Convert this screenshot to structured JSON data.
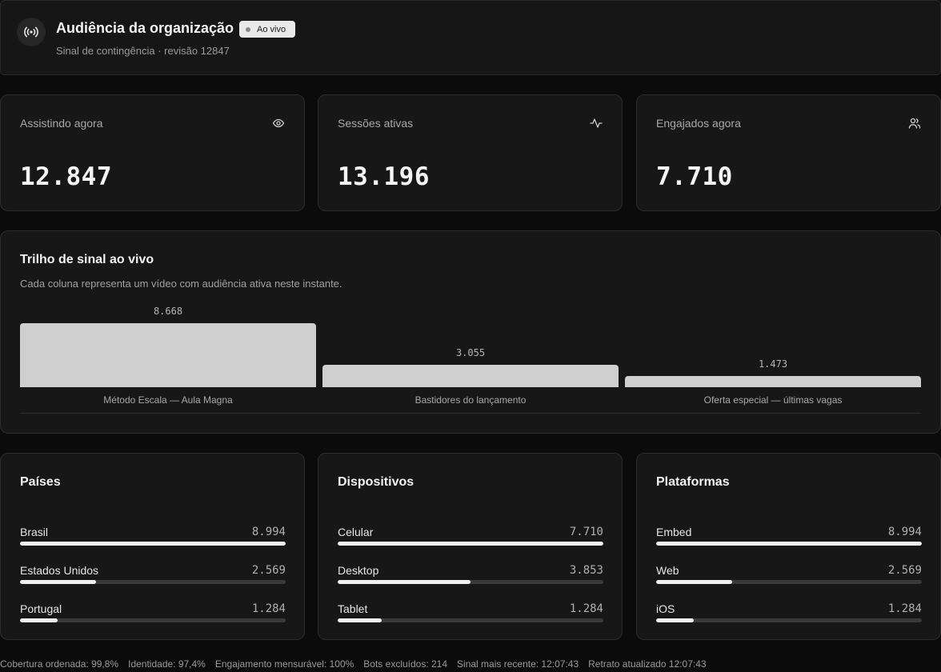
{
  "header": {
    "title": "Audiência da organização",
    "badge": "Ao vivo",
    "subtitle": "Sinal de contingência · revisão 12847"
  },
  "stats": [
    {
      "label": "Assistindo agora",
      "value": "12.847",
      "icon": "eye-icon"
    },
    {
      "label": "Sessões ativas",
      "value": "13.196",
      "icon": "activity-icon"
    },
    {
      "label": "Engajados agora",
      "value": "7.710",
      "icon": "users-icon"
    }
  ],
  "trail": {
    "title": "Trilho de sinal ao vivo",
    "description": "Cada coluna representa um vídeo com audiência ativa neste instante.",
    "chart_data": {
      "type": "bar",
      "categories": [
        "Método Escala — Aula Magna",
        "Bastidores do lançamento",
        "Oferta especial — últimas vagas"
      ],
      "values": [
        8668,
        3055,
        1473
      ],
      "value_labels": [
        "8.668",
        "3.055",
        "1.473"
      ]
    }
  },
  "breakdowns": [
    {
      "title": "Países",
      "rows": [
        {
          "name": "Brasil",
          "value": "8.994",
          "fraction": 1.0
        },
        {
          "name": "Estados Unidos",
          "value": "2.569",
          "fraction": 0.286
        },
        {
          "name": "Portugal",
          "value": "1.284",
          "fraction": 0.143
        }
      ]
    },
    {
      "title": "Dispositivos",
      "rows": [
        {
          "name": "Celular",
          "value": "7.710",
          "fraction": 1.0
        },
        {
          "name": "Desktop",
          "value": "3.853",
          "fraction": 0.5
        },
        {
          "name": "Tablet",
          "value": "1.284",
          "fraction": 0.167
        }
      ]
    },
    {
      "title": "Plataformas",
      "rows": [
        {
          "name": "Embed",
          "value": "8.994",
          "fraction": 1.0
        },
        {
          "name": "Web",
          "value": "2.569",
          "fraction": 0.286
        },
        {
          "name": "iOS",
          "value": "1.284",
          "fraction": 0.143
        }
      ]
    }
  ],
  "footer": [
    "Cobertura ordenada: 99,8%",
    "Identidade: 97,4%",
    "Engajamento mensurável: 100%",
    "Bots excluídos: 214",
    "Sinal mais recente: 12:07:43",
    "Retrato atualizado 12:07:43"
  ]
}
